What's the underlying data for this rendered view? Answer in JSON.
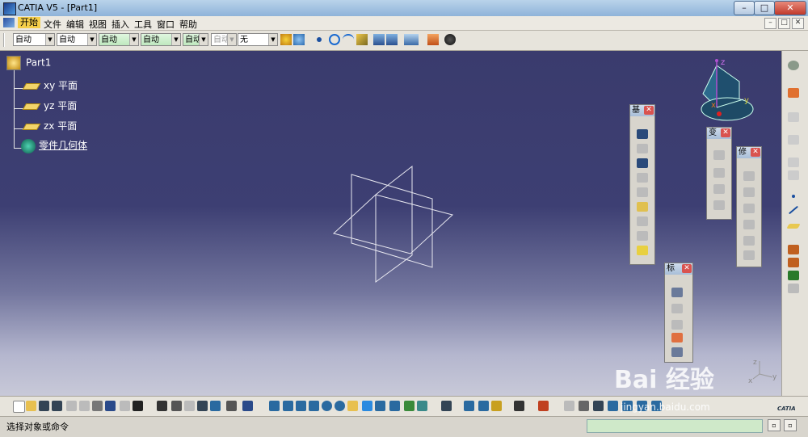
{
  "window": {
    "title": "CATIA V5 - [Part1]",
    "min": "–",
    "max": "□",
    "close": "✕"
  },
  "menu": {
    "items": [
      "开始",
      "文件",
      "编辑",
      "视图",
      "插入",
      "工具",
      "窗口",
      "帮助"
    ],
    "mdi_min": "–",
    "mdi_max": "□",
    "mdi_close": "✕"
  },
  "toolbar": {
    "combos": [
      "自动",
      "自动",
      "自动",
      "自动",
      "自动",
      "自动",
      "无"
    ]
  },
  "tree": {
    "root": "Part1",
    "items": [
      "xy 平面",
      "yz 平面",
      "zx 平面",
      "零件几何体"
    ]
  },
  "palettes": {
    "p1_title": "基",
    "p2_title": "变",
    "p3_title": "修",
    "p4_title": "标"
  },
  "compass": {
    "x": "x",
    "y": "y",
    "z": "z"
  },
  "axis_small": {
    "x": "x",
    "y": "y",
    "z": "z"
  },
  "watermark": {
    "main": "Bai 经验",
    "url": "jingyan.baidu.com"
  },
  "catia_logo": "CATIA",
  "status": {
    "text": "选择对象或命令"
  },
  "colors": {
    "viewport_top": "#3a3b6d",
    "viewport_bottom": "#c8c9d8",
    "menu_active": "#f5cf4a"
  }
}
